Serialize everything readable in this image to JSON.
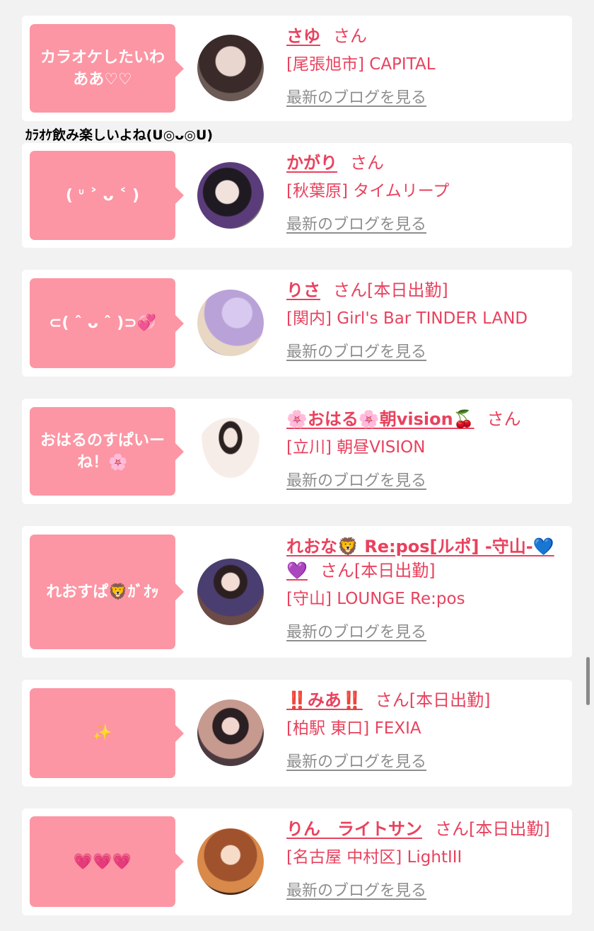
{
  "outside_message": "ｶﾗｵｹ飲み楽しいよね(U◎ᴗ◎U)",
  "blog_link_label": "最新のブログを見る",
  "san_label": "さん",
  "colors": {
    "accent": "#e8425e",
    "bubble": "#fc96a4",
    "link_gray": "#8e8e8e"
  },
  "entries": [
    {
      "message": "カラオケしたいわああ♡♡",
      "name": "さゆ",
      "status": "",
      "shop": "[尾張旭市] CAPITAL"
    },
    {
      "message": "( ᐡ ˃ ᴗ ˂ )",
      "name": "かがり",
      "status": "",
      "shop": "[秋葉原] タイムリープ"
    },
    {
      "message": "⊂( ˆ ᴗ ˆ )⊃💞",
      "name": "りさ",
      "status": "[本日出勤]",
      "shop": "[関内] Girl's Bar TINDER LAND"
    },
    {
      "message": "おはるのすぱいーね！🌸",
      "name": "🌸おはる🌸朝vision🍒",
      "status": "",
      "shop": "[立川] 朝昼VISION"
    },
    {
      "message": "れおすぱ🦁ｶﾞｵｯ",
      "name": "れおな🦁 Re:pos[ルポ] -守山-💙💜",
      "status": "[本日出勤]",
      "shop": "[守山] LOUNGE Re:pos"
    },
    {
      "message": "✨",
      "name": "‼️みあ‼️",
      "status": "[本日出勤]",
      "shop": "[柏駅 東口] FEXIA"
    },
    {
      "message": "💗💗💗",
      "name": "りん　ライトサン",
      "status": "[本日出勤]",
      "shop": "[名古屋 中村区] LightIII"
    }
  ]
}
